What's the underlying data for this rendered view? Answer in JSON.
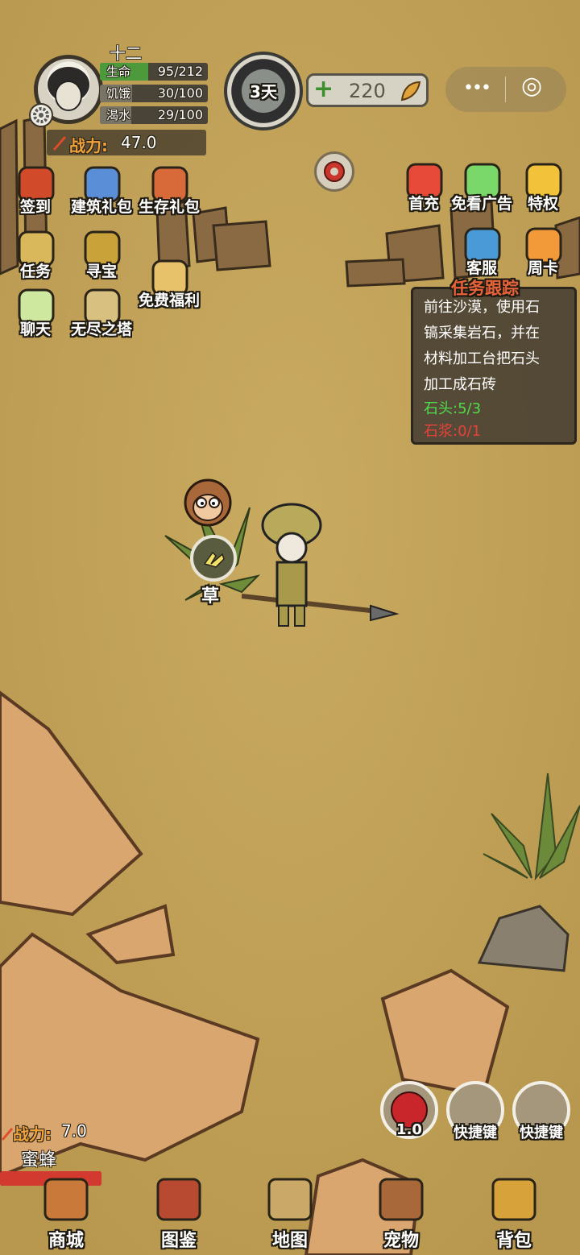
{
  "player": {
    "name": "十二",
    "stats": [
      {
        "label": "生命",
        "value": "95/212",
        "fraction": 0.448,
        "color": "#4c9a3c"
      },
      {
        "label": "饥饿",
        "value": "30/100",
        "fraction": 0.3,
        "color": "#7a7466"
      },
      {
        "label": "渴水",
        "value": "29/100",
        "fraction": 0.29,
        "color": "#7a7466"
      }
    ],
    "power_label": "战力:",
    "power_value": "47.0"
  },
  "day": {
    "label": "3天"
  },
  "currency": {
    "plus": "+",
    "amount": "220"
  },
  "capsule": {
    "more": "•••",
    "close": "◎"
  },
  "menu_left": [
    {
      "label": "签到",
      "icon": "signin-flag-icon"
    },
    {
      "label": "建筑礼包",
      "icon": "building-gift-icon"
    },
    {
      "label": "生存礼包",
      "icon": "survival-gift-icon"
    },
    {
      "label": "任务",
      "icon": "scroll-task-icon"
    },
    {
      "label": "寻宝",
      "icon": "treasure-hunt-icon"
    },
    {
      "label": "免费福利",
      "icon": "free-welfare-icon"
    },
    {
      "label": "聊天",
      "icon": "chat-bubble-icon"
    },
    {
      "label": "无尽之塔",
      "icon": "crossed-swords-icon"
    }
  ],
  "menu_right": [
    {
      "label": "首充",
      "icon": "first-recharge-gift-icon"
    },
    {
      "label": "免看广告",
      "icon": "no-ads-camera-icon"
    },
    {
      "label": "特权",
      "icon": "privilege-diamond-icon"
    },
    {
      "label": "客服",
      "icon": "headset-service-icon"
    },
    {
      "label": "周卡",
      "icon": "weekly-card-icon"
    }
  ],
  "quest": {
    "title": "任务跟踪",
    "lines": [
      "前往沙漠，使用石",
      "镐采集岩石，并在",
      "材料加工台把石头",
      "加工成石砖"
    ],
    "progress": [
      {
        "text": "石头:5/3",
        "color": "#4fdc4a"
      },
      {
        "text": "石浆:0/1",
        "color": "#e8413a"
      }
    ]
  },
  "world": {
    "grass_label": "草",
    "grass_icon": "gather-hand-icon"
  },
  "enemy": {
    "power_label": "战力:",
    "power_value": "7.0",
    "name": "蜜蜂",
    "hp_fraction": 1.0
  },
  "quick_slots": [
    {
      "label": "1.0",
      "icon": "apple-icon"
    },
    {
      "label": "快捷键",
      "icon": ""
    },
    {
      "label": "快捷键",
      "icon": ""
    }
  ],
  "nav": [
    {
      "label": "商城",
      "icon": "shop-stall-icon"
    },
    {
      "label": "图鉴",
      "icon": "codex-book-icon"
    },
    {
      "label": "地图",
      "icon": "map-scroll-icon"
    },
    {
      "label": "宠物",
      "icon": "monkey-pet-icon"
    },
    {
      "label": "背包",
      "icon": "backpack-icon"
    }
  ]
}
